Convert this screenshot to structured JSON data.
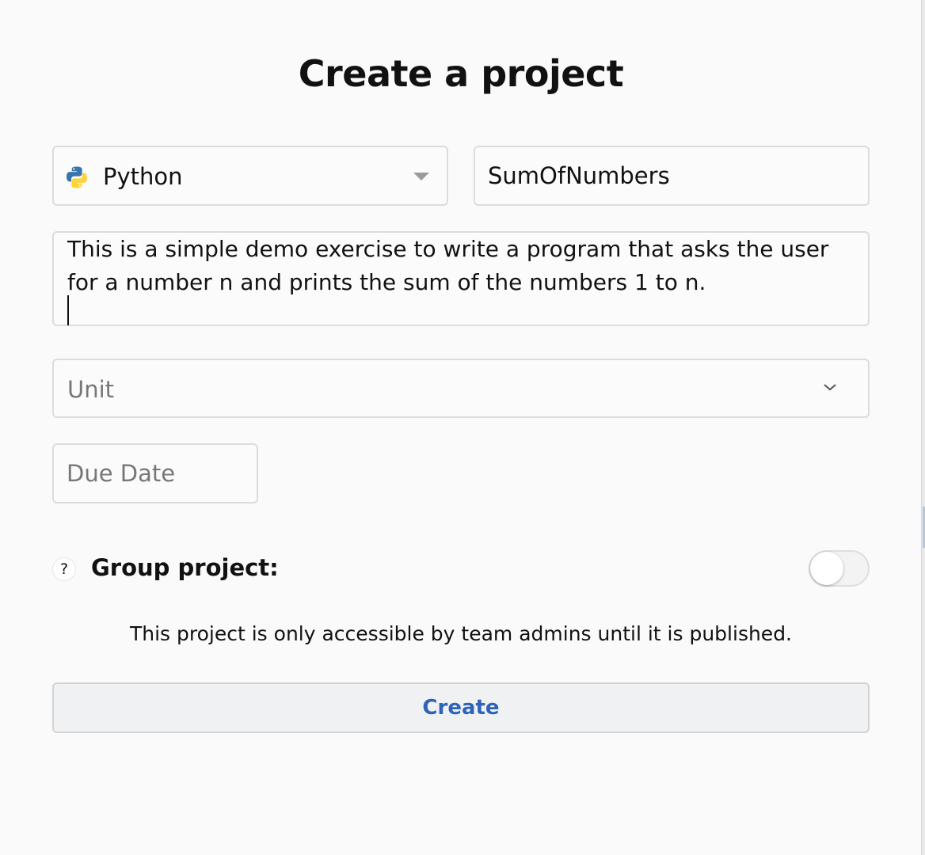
{
  "dialog": {
    "title": "Create a project",
    "language": {
      "selected": "Python",
      "icon": "python-logo-icon"
    },
    "project_name": {
      "value": "SumOfNumbers"
    },
    "description": {
      "value": "This is a simple demo exercise to write a program that asks the user for a number n and prints the sum of the numbers 1 to n."
    },
    "unit": {
      "placeholder": "Unit"
    },
    "due_date": {
      "placeholder": "Due Date"
    },
    "group_project": {
      "help_icon_text": "?",
      "label": "Group project:",
      "enabled": false
    },
    "notice": "This project is only accessible by team admins until it is published.",
    "create_label": "Create"
  },
  "colors": {
    "accent": "#2d63b8",
    "python_blue": "#3776ab",
    "python_yellow": "#ffd43b"
  }
}
